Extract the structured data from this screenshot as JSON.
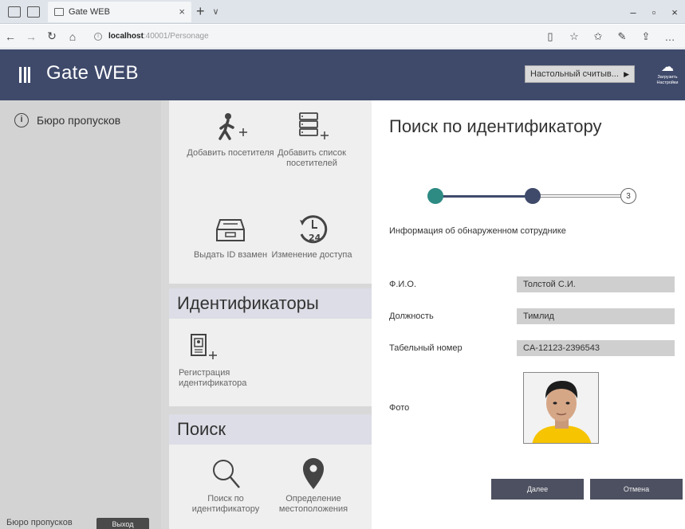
{
  "browser": {
    "tab_title": "Gate WEB",
    "tab_close": "×",
    "new_tab": "+",
    "tab_dropdown": "∨",
    "url_host": "localhost",
    "url_path": ":40001/Personage",
    "win_minimize": "–",
    "win_maximize": "▫",
    "win_close": "×"
  },
  "app": {
    "title": "Gate WEB",
    "reader_label": "Настольный считыв...",
    "cloud_label_line1": "Загрузить",
    "cloud_label_line2": "Настройки"
  },
  "sidebar": {
    "item_label": "Бюро пропусков",
    "footer_label": "Бюро пропусков",
    "exit_label": "Выход"
  },
  "middle": {
    "tiles_top": [
      {
        "label": "Добавить посетителя",
        "icon": "walking-person-plus-icon"
      },
      {
        "label": "Добавить список посетителей",
        "icon": "list-plus-icon"
      },
      {
        "label": "Выдать ID взамен",
        "icon": "inbox-tray-icon"
      },
      {
        "label": "Изменение доступа",
        "icon": "clock-24-icon"
      }
    ],
    "section_ids": "Идентификаторы",
    "tile_register": {
      "label": "Регистрация идентификатора",
      "icon": "badge-plus-icon"
    },
    "section_search": "Поиск",
    "tiles_search": [
      {
        "label": "Поиск по идентификатору",
        "icon": "magnifier-icon"
      },
      {
        "label": "Определение местоположения",
        "icon": "location-pin-icon"
      }
    ]
  },
  "right": {
    "title": "Поиск по идентификатору",
    "steps": [
      "1",
      "2",
      "3"
    ],
    "info_text": "Информация об обнаруженном сотруднике",
    "fields": [
      {
        "label": "Ф.И.О.",
        "value": "Толстой С.И."
      },
      {
        "label": "Должность",
        "value": "Тимлид"
      },
      {
        "label": "Табельный номер",
        "value": "CA-12123-2396543"
      }
    ],
    "photo_label": "Фото",
    "next_label": "Далее",
    "cancel_label": "Отмена"
  },
  "colors": {
    "header_bg": "#3f4a6b",
    "step_done": "#2e8b84",
    "step_active": "#3f4a6b",
    "button_bg": "#4d5060"
  }
}
